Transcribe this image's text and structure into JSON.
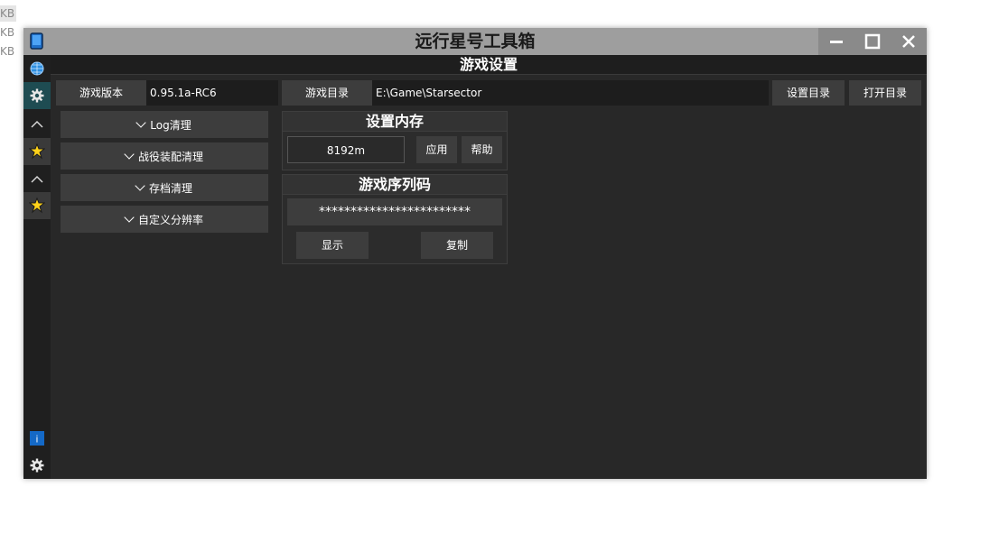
{
  "background": {
    "kb_labels": [
      "KB",
      "KB",
      "KB"
    ]
  },
  "window": {
    "title": "远行星号工具箱",
    "controls": {
      "minimize": "minimize-icon",
      "maximize": "maximize-icon",
      "close": "close-icon"
    }
  },
  "sidebar": {
    "items": [
      {
        "icon": "globe-icon"
      },
      {
        "icon": "gear-icon",
        "active": true
      },
      {
        "icon": "chevron-up-icon"
      },
      {
        "icon": "star-badge-icon"
      },
      {
        "icon": "chevron-up-icon"
      },
      {
        "icon": "star-badge-icon"
      }
    ],
    "bottom": [
      {
        "icon": "info-icon",
        "text": "i"
      },
      {
        "icon": "gear-icon"
      }
    ]
  },
  "header": {
    "title": "游戏设置"
  },
  "settings": {
    "version_label": "游戏版本",
    "version_value": "0.95.1a-RC6",
    "dir_label": "游戏目录",
    "dir_value": "E:\\Game\\Starsector",
    "set_dir_button": "设置目录",
    "open_dir_button": "打开目录"
  },
  "expanders": [
    "Log清理",
    "战役装配清理",
    "存档清理",
    "自定义分辨率"
  ],
  "memory": {
    "title": "设置内存",
    "value": "8192m",
    "apply": "应用",
    "help": "帮助"
  },
  "serial": {
    "title": "游戏序列码",
    "value": "************************",
    "show": "显示",
    "copy": "复制"
  },
  "colors": {
    "window_bg": "#282828",
    "titlebar": "#9e9e9e",
    "button": "#3d3d3d",
    "accent": "#1e4c52",
    "info_blue": "#1469c7",
    "star_yellow": "#ffd21a"
  }
}
